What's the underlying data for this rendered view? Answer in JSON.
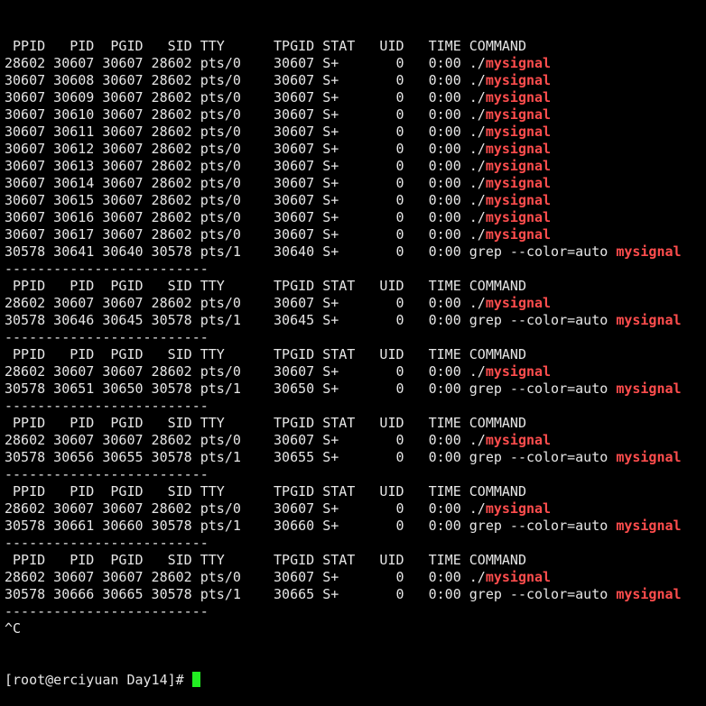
{
  "colors": {
    "background": "#000000",
    "foreground": "#e6e6e6",
    "match_highlight": "#ff4d4d",
    "cursor": "#22ee22"
  },
  "lines": [
    {
      "type": "header",
      "text": " PPID   PID  PGID   SID TTY      TPGID STAT   UID   TIME COMMAND"
    },
    {
      "type": "process",
      "pre": "28602 30607 30607 28602 pts/0    30607 S+       0   0:00 ./",
      "hl": "mysignal"
    },
    {
      "type": "process",
      "pre": "30607 30608 30607 28602 pts/0    30607 S+       0   0:00 ./",
      "hl": "mysignal"
    },
    {
      "type": "process",
      "pre": "30607 30609 30607 28602 pts/0    30607 S+       0   0:00 ./",
      "hl": "mysignal"
    },
    {
      "type": "process",
      "pre": "30607 30610 30607 28602 pts/0    30607 S+       0   0:00 ./",
      "hl": "mysignal"
    },
    {
      "type": "process",
      "pre": "30607 30611 30607 28602 pts/0    30607 S+       0   0:00 ./",
      "hl": "mysignal"
    },
    {
      "type": "process",
      "pre": "30607 30612 30607 28602 pts/0    30607 S+       0   0:00 ./",
      "hl": "mysignal"
    },
    {
      "type": "process",
      "pre": "30607 30613 30607 28602 pts/0    30607 S+       0   0:00 ./",
      "hl": "mysignal"
    },
    {
      "type": "process",
      "pre": "30607 30614 30607 28602 pts/0    30607 S+       0   0:00 ./",
      "hl": "mysignal"
    },
    {
      "type": "process",
      "pre": "30607 30615 30607 28602 pts/0    30607 S+       0   0:00 ./",
      "hl": "mysignal"
    },
    {
      "type": "process",
      "pre": "30607 30616 30607 28602 pts/0    30607 S+       0   0:00 ./",
      "hl": "mysignal"
    },
    {
      "type": "process",
      "pre": "30607 30617 30607 28602 pts/0    30607 S+       0   0:00 ./",
      "hl": "mysignal"
    },
    {
      "type": "process",
      "pre": "30578 30641 30640 30578 pts/1    30640 S+       0   0:00 grep --color=auto ",
      "hl": "mysignal"
    },
    {
      "type": "separator",
      "text": "-------------------------"
    },
    {
      "type": "header",
      "text": " PPID   PID  PGID   SID TTY      TPGID STAT   UID   TIME COMMAND"
    },
    {
      "type": "process",
      "pre": "28602 30607 30607 28602 pts/0    30607 S+       0   0:00 ./",
      "hl": "mysignal"
    },
    {
      "type": "process",
      "pre": "30578 30646 30645 30578 pts/1    30645 S+       0   0:00 grep --color=auto ",
      "hl": "mysignal"
    },
    {
      "type": "separator",
      "text": "-------------------------"
    },
    {
      "type": "header",
      "text": " PPID   PID  PGID   SID TTY      TPGID STAT   UID   TIME COMMAND"
    },
    {
      "type": "process",
      "pre": "28602 30607 30607 28602 pts/0    30607 S+       0   0:00 ./",
      "hl": "mysignal"
    },
    {
      "type": "process",
      "pre": "30578 30651 30650 30578 pts/1    30650 S+       0   0:00 grep --color=auto ",
      "hl": "mysignal"
    },
    {
      "type": "separator",
      "text": "-------------------------"
    },
    {
      "type": "header",
      "text": " PPID   PID  PGID   SID TTY      TPGID STAT   UID   TIME COMMAND"
    },
    {
      "type": "process",
      "pre": "28602 30607 30607 28602 pts/0    30607 S+       0   0:00 ./",
      "hl": "mysignal"
    },
    {
      "type": "process",
      "pre": "30578 30656 30655 30578 pts/1    30655 S+       0   0:00 grep --color=auto ",
      "hl": "mysignal"
    },
    {
      "type": "separator",
      "text": "-------------------------"
    },
    {
      "type": "header",
      "text": " PPID   PID  PGID   SID TTY      TPGID STAT   UID   TIME COMMAND"
    },
    {
      "type": "process",
      "pre": "28602 30607 30607 28602 pts/0    30607 S+       0   0:00 ./",
      "hl": "mysignal"
    },
    {
      "type": "process",
      "pre": "30578 30661 30660 30578 pts/1    30660 S+       0   0:00 grep --color=auto ",
      "hl": "mysignal"
    },
    {
      "type": "separator",
      "text": "-------------------------"
    },
    {
      "type": "header",
      "text": " PPID   PID  PGID   SID TTY      TPGID STAT   UID   TIME COMMAND"
    },
    {
      "type": "process",
      "pre": "28602 30607 30607 28602 pts/0    30607 S+       0   0:00 ./",
      "hl": "mysignal"
    },
    {
      "type": "process",
      "pre": "30578 30666 30665 30578 pts/1    30665 S+       0   0:00 grep --color=auto ",
      "hl": "mysignal"
    },
    {
      "type": "separator",
      "text": "-------------------------"
    },
    {
      "type": "interrupt",
      "text": "^C"
    }
  ],
  "prompt": {
    "text": "[root@erciyuan Day14]# "
  }
}
